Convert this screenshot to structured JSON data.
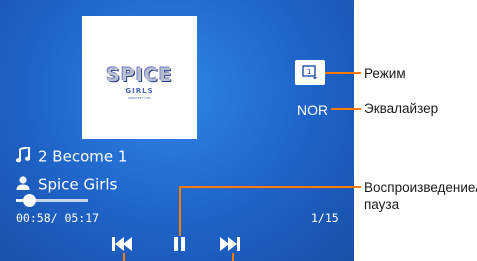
{
  "album": {
    "logo_text": "SPICE",
    "logo_sub": "GIRLS",
    "logo_sub2": "GREATEST HITS"
  },
  "track": {
    "title_icon": "music-note-icon",
    "title": "2 Become 1",
    "artist_icon": "person-icon",
    "artist": "Spice Girls"
  },
  "playback": {
    "time": "00:58/ 05:17",
    "progress_fraction": 0.183,
    "track_count": "1/15"
  },
  "controls": {
    "mode_icon": "repeat-one-icon",
    "eq_value": "NOR",
    "prev_icon": "skip-previous-icon",
    "pause_icon": "pause-icon",
    "next_icon": "skip-next-icon"
  },
  "callouts": {
    "mode": "Режим",
    "equalizer": "Эквалайзер",
    "play_pause_line1": "Воспроизведение/",
    "play_pause_line2": "пауза"
  },
  "colors": {
    "screen_bg": "#1f63c7",
    "callout_line": "#ff7a00"
  }
}
